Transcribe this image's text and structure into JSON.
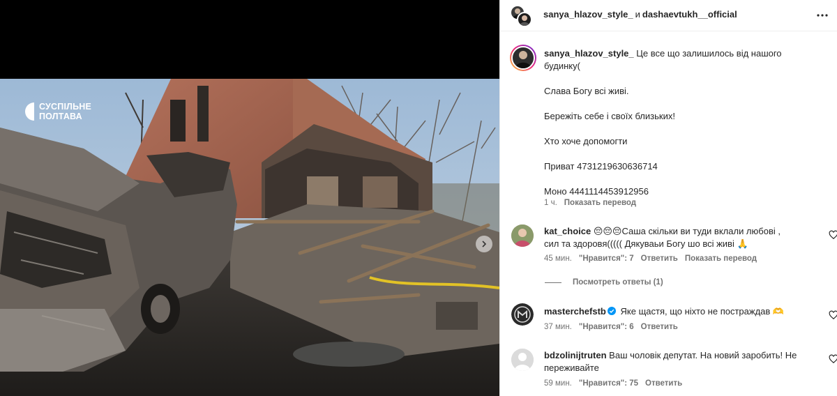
{
  "watermark": {
    "line1": "СУСПІЛЬНЕ",
    "line2": "ПОЛТАВА"
  },
  "header": {
    "user1": "sanya_hlazov_style_",
    "conj": "и",
    "user2": "dashaevtukh__official",
    "more_icon": "more-horizontal-icon"
  },
  "caption": {
    "username": "sanya_hlazov_style_",
    "lines": [
      "Це все що залишилось від нашого",
      "будинку(",
      "Слава Богу всі живі.",
      "Бережіть себе і своїх близьких!",
      "Хто хоче допомогти",
      "Приват 4731219630636714",
      "Моно 4441114453912956"
    ],
    "time": "1 ч.",
    "translate": "Показать перевод"
  },
  "comments": [
    {
      "username": "kat_choice",
      "text_line1": "😔😔😔Саша скільки ви туди вклали любові ,",
      "text_line2": "сил та здоровя((((( Дякуваьи Богу шо всі живі 🙏",
      "time": "45 мин.",
      "likes": "\"Нравится\": 7",
      "reply": "Ответить",
      "translate": "Показать перевод",
      "view_replies": "Посмотреть ответы (1)"
    },
    {
      "username": "masterchefstb",
      "verified": true,
      "text_line1": "Яке щастя, що ніхто не постраждав 🫶",
      "time": "37 мин.",
      "likes": "\"Нравится\": 6",
      "reply": "Ответить"
    },
    {
      "username": "bdzolinijtruten",
      "text_line1": "Ваш чоловік депутат. На новий заробить! Не",
      "text_line2": "переживайте",
      "time": "59 мин.",
      "likes": "\"Нравится\": 75",
      "reply": "Ответить"
    }
  ],
  "colors": {
    "text": "#262626",
    "secondary": "#737373",
    "divider": "#efefef",
    "verified": "#0095f6"
  }
}
